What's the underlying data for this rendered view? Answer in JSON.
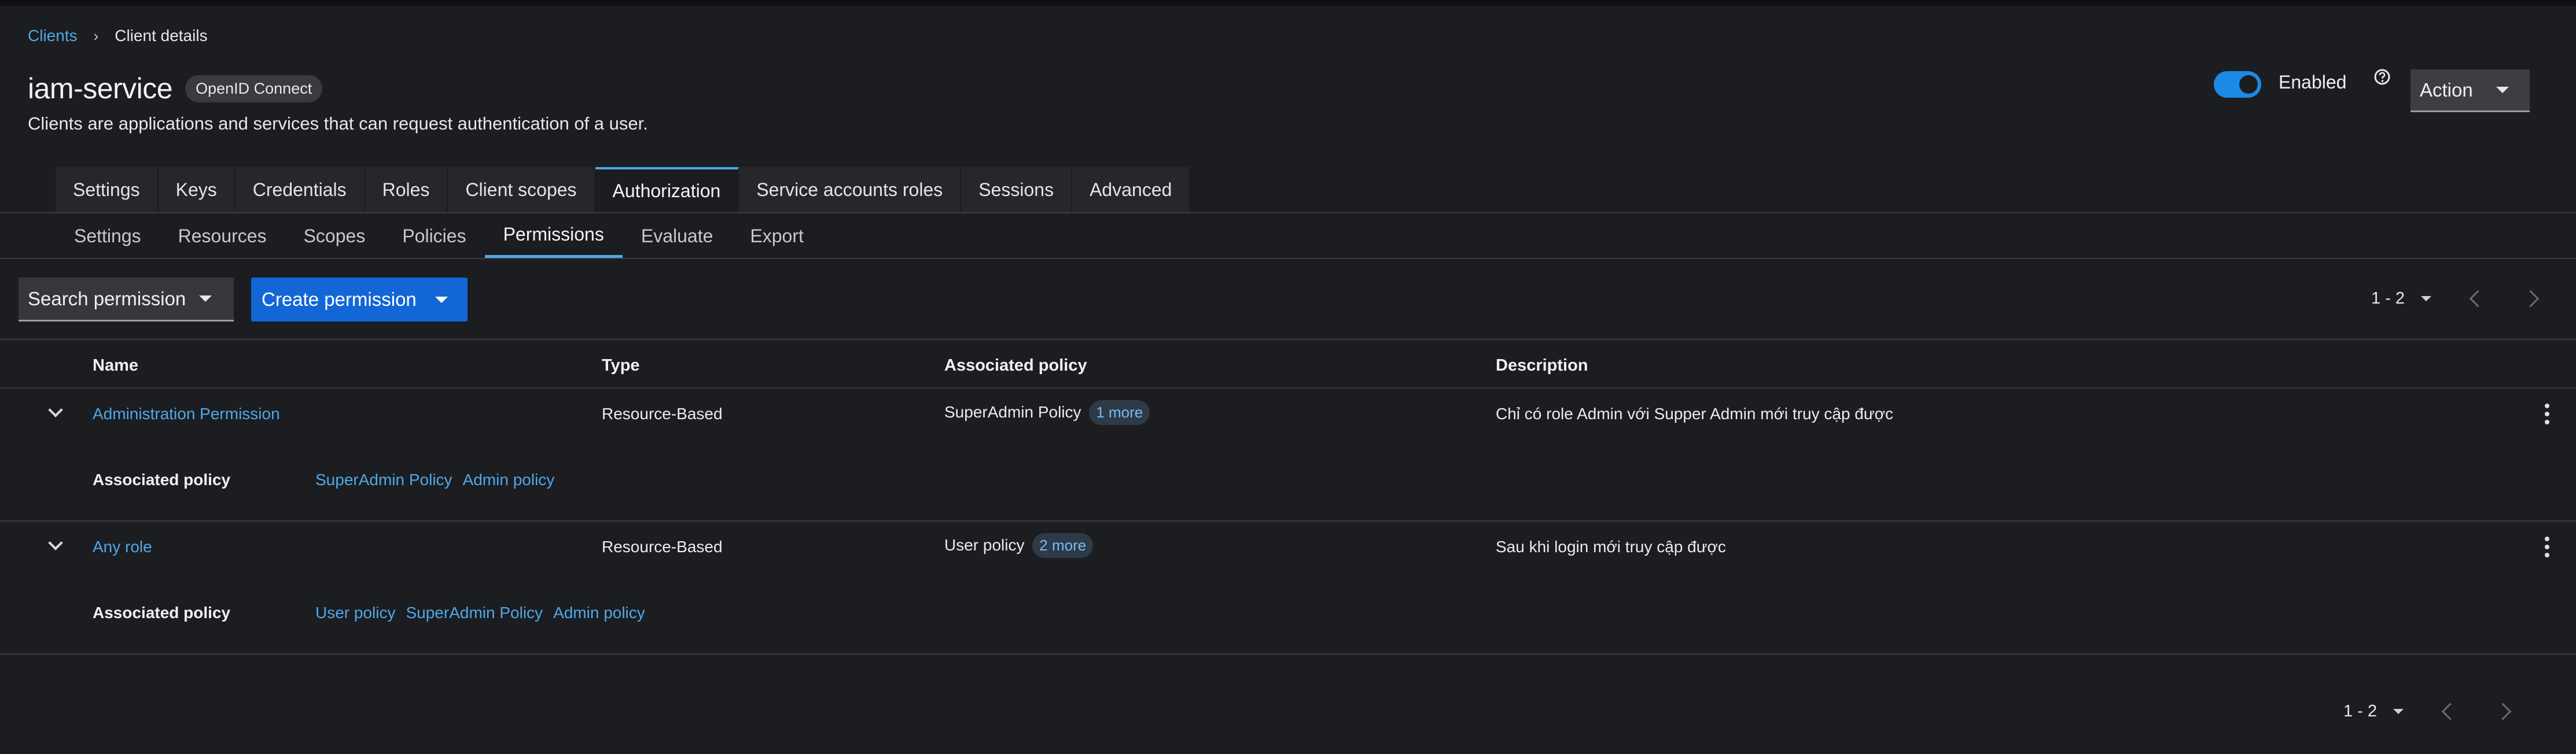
{
  "breadcrumb": {
    "parent": "Clients",
    "separator": "›",
    "current": "Client details"
  },
  "header": {
    "title": "iam-service",
    "protocol_badge": "OpenID Connect",
    "subtitle": "Clients are applications and services that can request authentication of a user.",
    "enabled_label": "Enabled",
    "enabled": true,
    "action_label": "Action"
  },
  "main_tabs": [
    {
      "label": "Settings"
    },
    {
      "label": "Keys"
    },
    {
      "label": "Credentials"
    },
    {
      "label": "Roles"
    },
    {
      "label": "Client scopes"
    },
    {
      "label": "Authorization"
    },
    {
      "label": "Service accounts roles"
    },
    {
      "label": "Sessions"
    },
    {
      "label": "Advanced"
    }
  ],
  "sub_tabs": [
    {
      "label": "Settings"
    },
    {
      "label": "Resources"
    },
    {
      "label": "Scopes"
    },
    {
      "label": "Policies"
    },
    {
      "label": "Permissions"
    },
    {
      "label": "Evaluate"
    },
    {
      "label": "Export"
    }
  ],
  "toolbar": {
    "search_label": "Search permission",
    "create_label": "Create permission"
  },
  "pagination": {
    "range": "1 - 2"
  },
  "table": {
    "columns": {
      "name": "Name",
      "type": "Type",
      "policy": "Associated policy",
      "description": "Description"
    },
    "rows": [
      {
        "name": "Administration Permission",
        "type": "Resource-Based",
        "policy": "SuperAdmin Policy",
        "more": "1 more",
        "description": "Chỉ có role Admin với Supper Admin mới truy cập được",
        "expanded_label": "Associated policy",
        "policies": [
          "SuperAdmin Policy",
          "Admin policy"
        ]
      },
      {
        "name": "Any role",
        "type": "Resource-Based",
        "policy": "User policy",
        "more": "2 more",
        "description": "Sau khi login mới truy cập được",
        "expanded_label": "Associated policy",
        "policies": [
          "User policy",
          "SuperAdmin Policy",
          "Admin policy"
        ]
      }
    ]
  },
  "colors": {
    "accent": "#4fa8e8",
    "primary_button": "#1366d6",
    "background": "#1c1d21"
  }
}
